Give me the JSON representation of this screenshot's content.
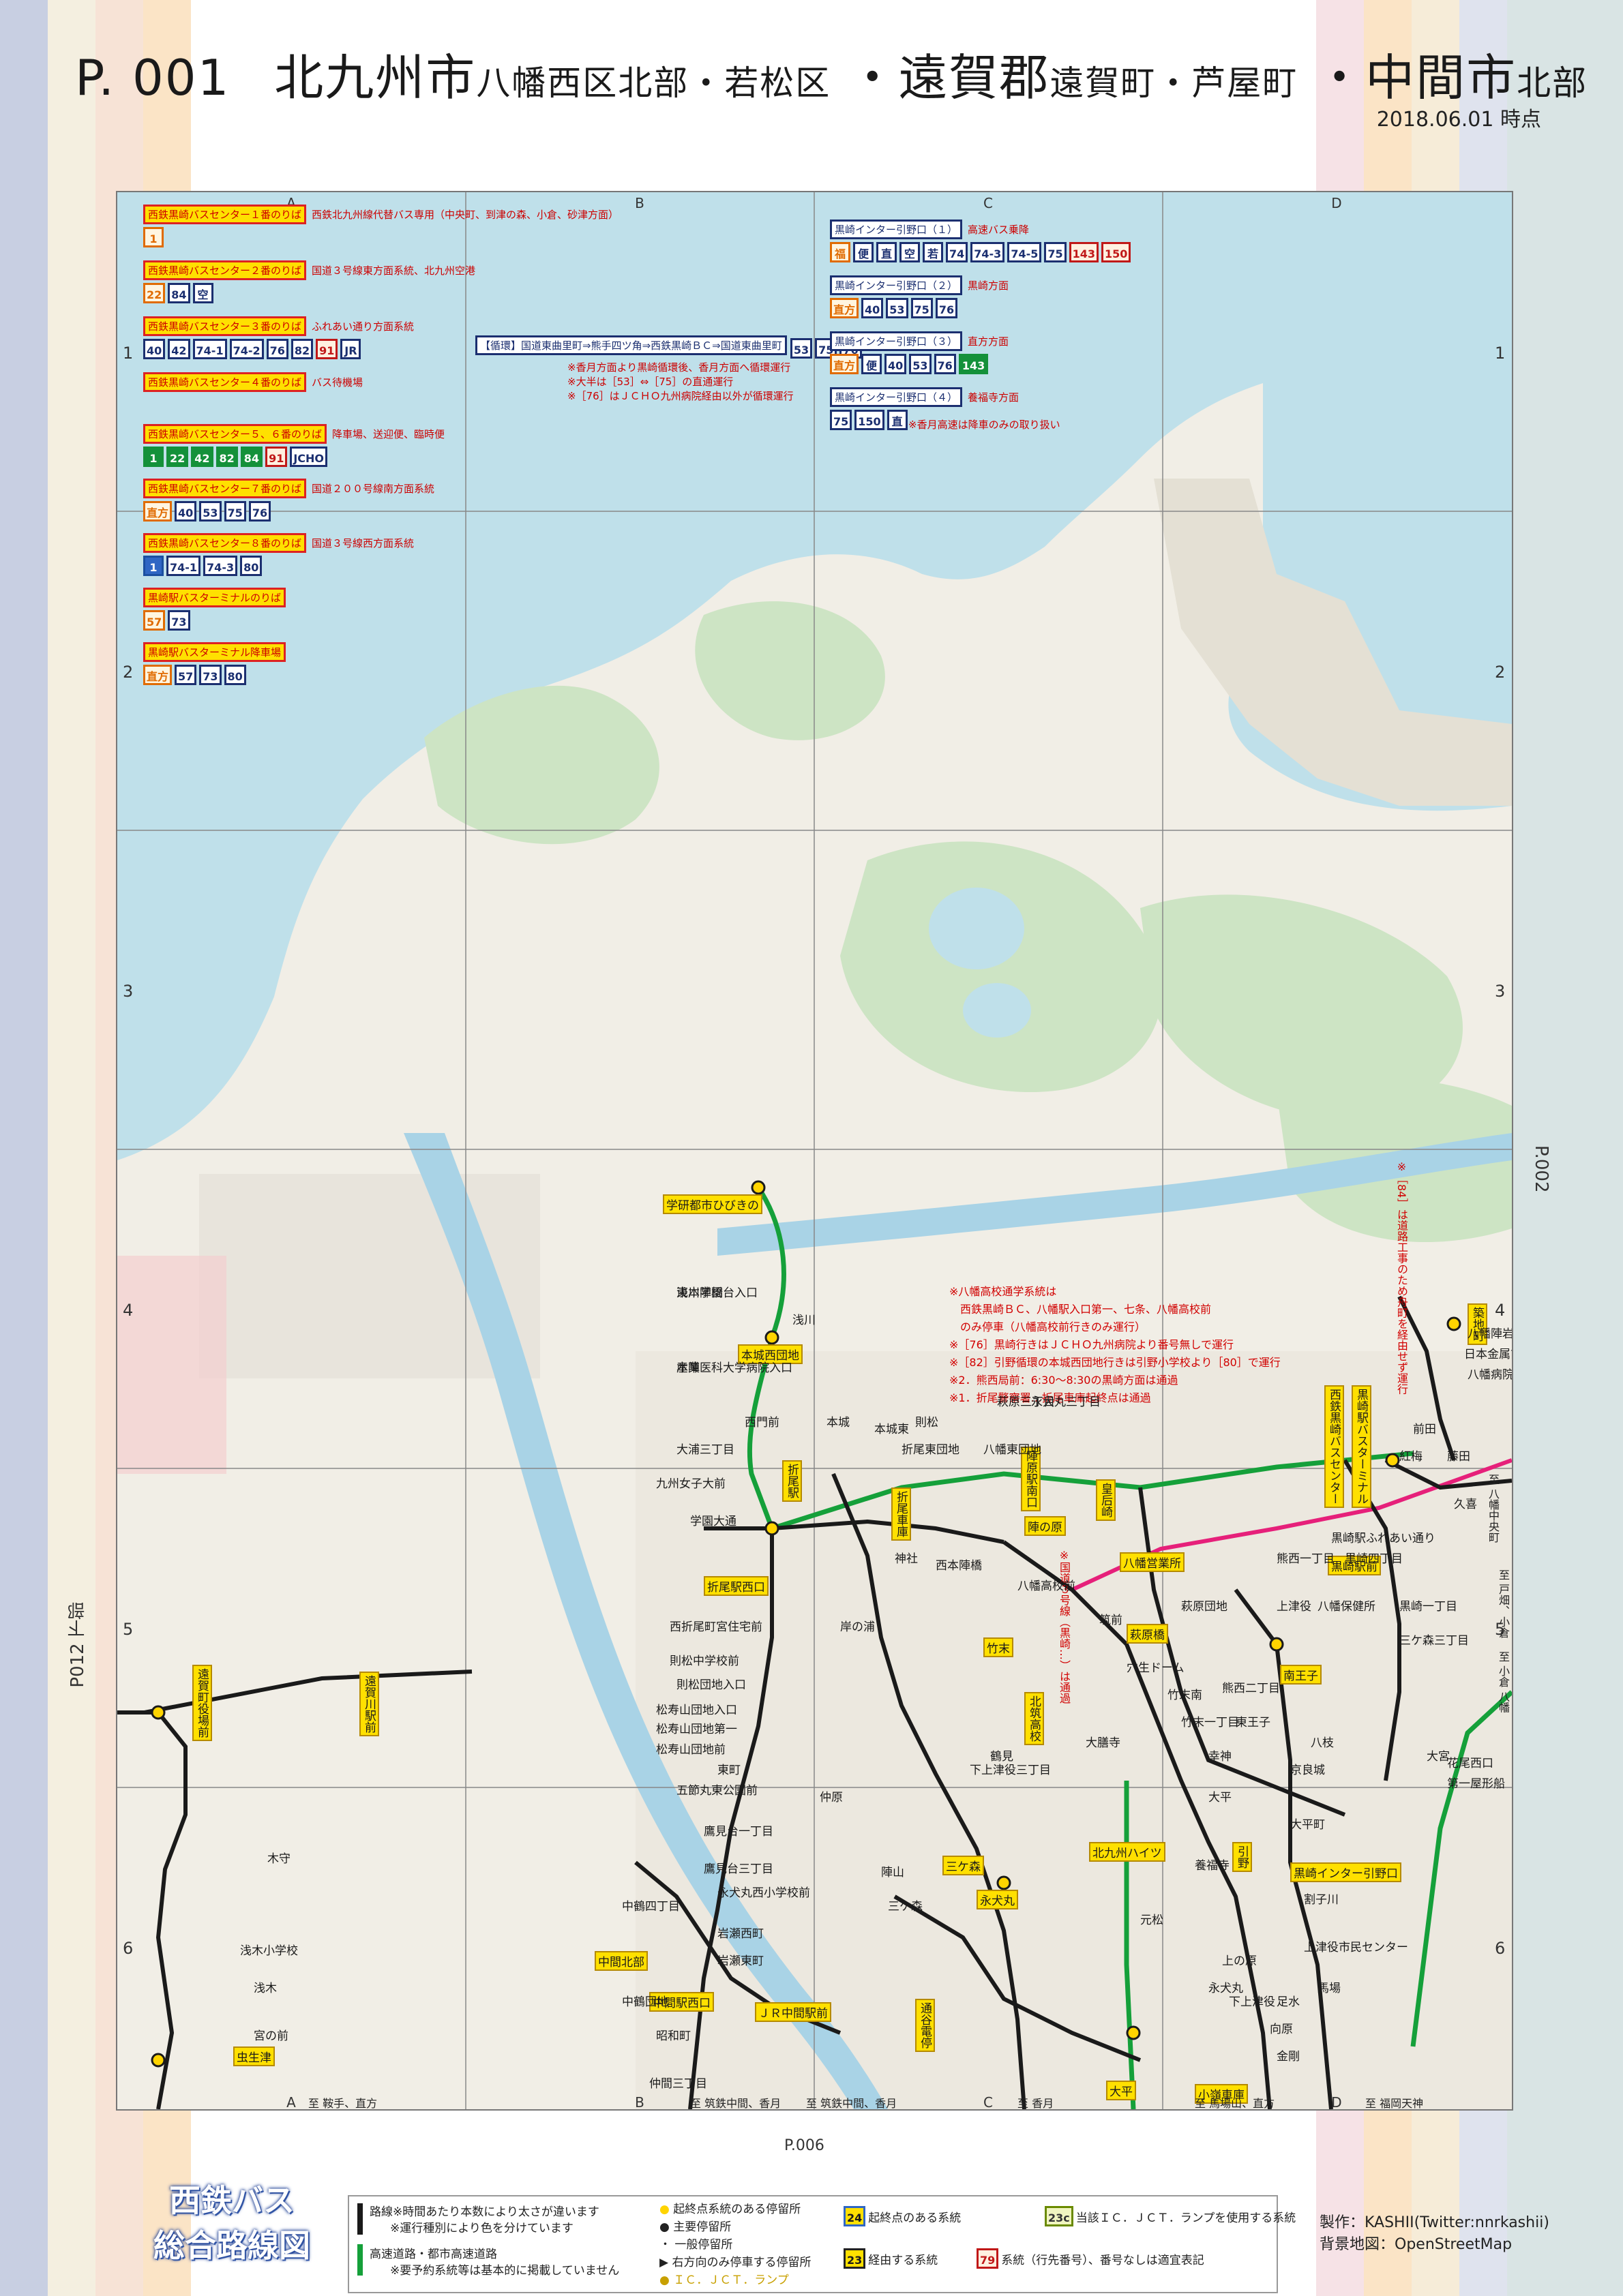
{
  "header": {
    "page_no": "P. 001",
    "city1": "北九州市",
    "city1_sub": "八幡西区北部・若松区",
    "sep1": "・",
    "city2": "遠賀郡",
    "city2_sub": "遠賀町・芦屋町",
    "sep2": "・",
    "city3": "中間市",
    "city3_sub": "北部",
    "date": "2018.06.01 時点"
  },
  "grid": {
    "columns": [
      "A",
      "B",
      "C",
      "D"
    ],
    "rows": [
      "1",
      "2",
      "3",
      "4",
      "5",
      "6"
    ],
    "bottom_columns": [
      "A",
      "B",
      "C",
      "D"
    ]
  },
  "side_labels": {
    "left": "P012 下部",
    "right": "P.002",
    "bottom": "P.006"
  },
  "bus_centers": [
    {
      "title": "西鉄黒崎バスセンター１番のりば",
      "desc": "西鉄北九州線代替バス専用（中央町、到津の森、小倉、砂津方面）",
      "chips": [
        {
          "t": "1",
          "c": "orange"
        }
      ]
    },
    {
      "title": "西鉄黒崎バスセンター２番のりば",
      "desc": "国道３号線東方面系統、北九州空港",
      "chips": [
        {
          "t": "22",
          "c": "orange"
        },
        {
          "t": "84",
          "c": "navy"
        },
        {
          "t": "空",
          "c": "navy"
        }
      ]
    },
    {
      "title": "西鉄黒崎バスセンター３番のりば",
      "desc": "ふれあい通り方面系統",
      "chips": [
        {
          "t": "40",
          "c": "navy"
        },
        {
          "t": "42",
          "c": "navy"
        },
        {
          "t": "74-1",
          "c": "navy"
        },
        {
          "t": "74-2",
          "c": "navy"
        },
        {
          "t": "76",
          "c": "navy"
        },
        {
          "t": "82",
          "c": "navy"
        },
        {
          "t": "91",
          "c": "red"
        },
        {
          "t": "JR",
          "c": "navy"
        }
      ]
    },
    {
      "title": "西鉄黒崎バスセンター４番のりば",
      "desc": "バス待機場",
      "chips": []
    },
    {
      "title": "西鉄黒崎バスセンター５、６番のりば",
      "desc": "降車場、送迎便、臨時便",
      "chips": [
        {
          "t": "1",
          "c": "green"
        },
        {
          "t": "22",
          "c": "green"
        },
        {
          "t": "42",
          "c": "green"
        },
        {
          "t": "82",
          "c": "green"
        },
        {
          "t": "84",
          "c": "green"
        },
        {
          "t": "91",
          "c": "red"
        },
        {
          "t": "JCHO",
          "c": "navy"
        }
      ]
    },
    {
      "title": "西鉄黒崎バスセンター７番のりば",
      "desc": "国道２００号線南方面系統",
      "chips": [
        {
          "t": "直方",
          "c": "orange"
        },
        {
          "t": "40",
          "c": "navy"
        },
        {
          "t": "53",
          "c": "navy"
        },
        {
          "t": "75",
          "c": "navy"
        },
        {
          "t": "76",
          "c": "navy"
        }
      ]
    },
    {
      "title": "西鉄黒崎バスセンター８番のりば",
      "desc": "国道３号線西方面系統",
      "chips": [
        {
          "t": "1",
          "c": "blue"
        },
        {
          "t": "74-1",
          "c": "navy"
        },
        {
          "t": "74-3",
          "c": "navy"
        },
        {
          "t": "80",
          "c": "navy"
        }
      ]
    },
    {
      "title": "黒崎駅バスターミナルのりば",
      "desc": "",
      "chips": [
        {
          "t": "57",
          "c": "orange"
        },
        {
          "t": "73",
          "c": "navy"
        }
      ]
    },
    {
      "title": "黒崎駅バスターミナル降車場",
      "desc": "",
      "chips": [
        {
          "t": "直方",
          "c": "orange"
        },
        {
          "t": "57",
          "c": "navy"
        },
        {
          "t": "73",
          "c": "navy"
        },
        {
          "t": "80",
          "c": "navy"
        }
      ]
    }
  ],
  "loop_box": {
    "title": "【循環】国道東曲里町⇒熊手四ツ角⇒西鉄黒崎ＢＣ⇒国道東曲里町",
    "chips": [
      {
        "t": "53",
        "c": "navy"
      },
      {
        "t": "75",
        "c": "navy"
      },
      {
        "t": "76",
        "c": "navy"
      }
    ],
    "notes": [
      "※香月方面より黒崎循環後、香月方面へ循環運行",
      "※大半は［53］⇔［75］の直通運行",
      "※［76］はＪＣＨＯ九州病院経由以外が循環運行"
    ]
  },
  "ic_boxes": [
    {
      "title": "黒崎インター引野口（１）",
      "desc": "高速バス乗降",
      "chips": [
        {
          "t": "福",
          "c": "orange"
        },
        {
          "t": "便",
          "c": "navy"
        },
        {
          "t": "直",
          "c": "navy"
        },
        {
          "t": "空",
          "c": "navy"
        },
        {
          "t": "若",
          "c": "navy"
        },
        {
          "t": "74",
          "c": "navy"
        },
        {
          "t": "74-3",
          "c": "navy"
        },
        {
          "t": "74-5",
          "c": "navy"
        },
        {
          "t": "75",
          "c": "navy"
        },
        {
          "t": "143",
          "c": "red"
        },
        {
          "t": "150",
          "c": "red"
        }
      ]
    },
    {
      "title": "黒崎インター引野口（２）",
      "desc": "黒崎方面",
      "chips": [
        {
          "t": "直方",
          "c": "orange"
        },
        {
          "t": "40",
          "c": "navy"
        },
        {
          "t": "53",
          "c": "navy"
        },
        {
          "t": "75",
          "c": "navy"
        },
        {
          "t": "76",
          "c": "navy"
        }
      ]
    },
    {
      "title": "黒崎インター引野口（３）",
      "desc": "直方方面",
      "chips": [
        {
          "t": "直方",
          "c": "orange"
        },
        {
          "t": "便",
          "c": "navy"
        },
        {
          "t": "40",
          "c": "navy"
        },
        {
          "t": "53",
          "c": "navy"
        },
        {
          "t": "76",
          "c": "navy"
        },
        {
          "t": "143",
          "c": "green"
        }
      ]
    },
    {
      "title": "黒崎インター引野口（４）",
      "desc": "養福寺方面",
      "chips": [
        {
          "t": "75",
          "c": "navy"
        },
        {
          "t": "150",
          "c": "navy"
        },
        {
          "t": "直",
          "c": "navy"
        }
      ]
    }
  ],
  "ic_note": "※香月高速は降車のみの取り扱い",
  "route_notes": [
    "※八幡高校通学系統は",
    "　西鉄黒崎ＢＣ、八幡駅入口第一、七条、八幡高校前",
    "　のみ停車（八幡高校前行きのみ運行）",
    "※［76］黒崎行きはＪＣＨＯ九州病院より番号無しで運行",
    "※［82］引野循環の本城西団地行きは引野小学校より［80］で運行",
    "※2．熊西局前：6:30～8:30の黒崎方面は通過",
    "※1．折尾警察署…折尾車庫起終点は通過"
  ],
  "map_notes": [
    "※［84］は道路工事のため舟町を経由せず運行",
    "※国道３号線（黒崎…）は通過"
  ],
  "places_hl": [
    "学研都市ひびきの",
    "本城西団地",
    "折尾駅",
    "折尾駅西口",
    "陣原駅南口",
    "陣の原",
    "皇后崎",
    "八幡営業所",
    "折尾車庫",
    "竹末",
    "北筑高校",
    "黒崎駅バスターミナル",
    "西鉄黒崎バスセンター",
    "黒崎インター引野口",
    "北九州ハイツ",
    "永犬丸",
    "引野",
    "萩原橋",
    "南王子",
    "築地町",
    "中間北部",
    "中間駅西口",
    "ＪＲ中間駅前",
    "通谷電停",
    "大平",
    "遠賀町役場前",
    "遠賀川駅前",
    "虫生津",
    "小嶺車庫",
    "三ケ森",
    "黒崎駅前"
  ],
  "places": [
    "浅川学園台入口",
    "産業医科大学病院入口",
    "西門前",
    "大浦三丁目",
    "九州女子大前",
    "学園大通",
    "西折尾町宮住宅前",
    "則松中学校前",
    "則松団地入口",
    "松寿山団地入口",
    "松寿山団地第一",
    "松寿山団地前",
    "東町",
    "五節丸東公園前",
    "鷹見台一丁目",
    "鷹見台三丁目",
    "永犬丸西小学校前",
    "中鶴四丁目",
    "岩瀬西町",
    "岩瀬東町",
    "中鶴団地",
    "昭和町",
    "仲間三丁目",
    "木守",
    "浅木小学校",
    "浅木",
    "宮の前",
    "穴生ドーム",
    "萩原団地",
    "熊西二丁目",
    "熊西一丁目",
    "黒崎駅ふれあい通り",
    "黒崎四丁目",
    "八幡保健所",
    "大平",
    "下上津役",
    "金剛",
    "上の原",
    "足水",
    "向原",
    "馬場",
    "上津役市民センター",
    "割子川",
    "養福寺",
    "大平町",
    "京良城",
    "八枝",
    "東王子",
    "黒崎一丁目",
    "三ケ森三丁目",
    "前田",
    "紅梅",
    "藤田",
    "久喜",
    "八幡病院",
    "日本金属前",
    "八幡陣岩前",
    "花尾西口",
    "第一屋形船",
    "大宮",
    "幸神",
    "大膳寺",
    "竹末南",
    "竹末一丁目",
    "岸の浦",
    "浅川",
    "本城",
    "本城東",
    "則松",
    "折尾東団地",
    "西本陣橋",
    "神社",
    "八幡高校前",
    "三ケ森",
    "仲原",
    "筑前",
    "陣山",
    "鶴見",
    "永犬丸",
    "元松",
    "下上津役三丁目",
    "上津役",
    "永犬丸三丁目",
    "萩原三丁目",
    "八幡東団地",
    "東本陣橋",
    "本陣"
  ],
  "dir_labels": {
    "right_top": "至 八幡中央町",
    "right_mid1": "至 戸畑、小倉",
    "right_mid2": "至 小倉 八幡",
    "bottom_a": "至 鞍手、直方",
    "bottom_b1": "至 筑鉄中間、香月",
    "bottom_b2": "至 筑鉄中間、香月",
    "bottom_c": "至 香月",
    "bottom_d1": "至 馬場山、直方",
    "bottom_d2": "至 福岡天神"
  },
  "footer": {
    "logo_line1": "西鉄バス",
    "logo_line2": "総合路線図",
    "legend": {
      "line1a": "路線※時間あたり本数により太さが違います",
      "line1b": "※運行種別により色を分けています",
      "line2a": "高速道路・都市高速道路",
      "line2b": "※要予約系統等は基本的に掲載していません",
      "stop1": "起終点系統のある停留所",
      "stop2": "主要停留所",
      "stop3": "一般停留所",
      "stop4": "右方向のみ停車する停留所",
      "stop5": "ＩＣ．ＪＣＴ．ランプ",
      "chip1_num": "24",
      "chip1_label": "起終点のある系統",
      "chip2_num": "23",
      "chip2_label": "経由する系統",
      "chip3_num": "23c",
      "chip3_label": "当該ＩＣ．ＪＣＴ．ランプを使用する系統",
      "chip4_num": "79",
      "chip4_label": "系統（行先番号）、番号なしは適宜表記"
    },
    "credit1": "製作：KASHII(Twitter:nnrkashii)",
    "credit2": "背景地図：OpenStreetMap"
  },
  "colors": {
    "sea": "#bfe0ea",
    "land": "#f1eee6",
    "forest": "#cde4c4",
    "road_main": "#1a1a1a",
    "route_green": "#15a03a",
    "expressway": "#e6207a",
    "river": "#a9d3e6",
    "accent_yellow": "#ffe000",
    "accent_red": "#d10000"
  }
}
